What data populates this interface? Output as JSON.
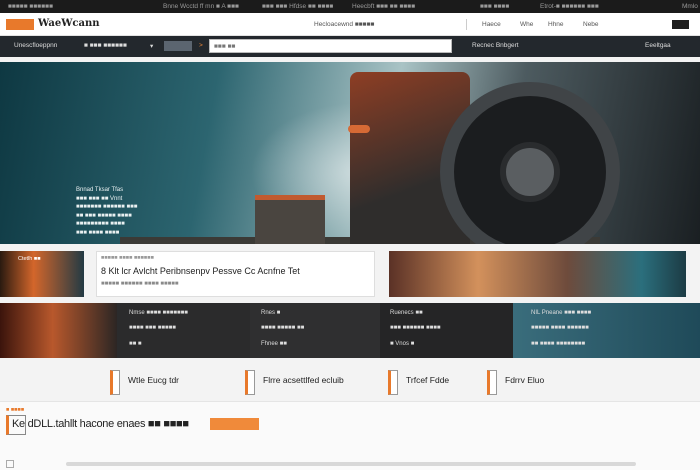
{
  "topbar": {
    "left": "■■■■■ ■■■■■■",
    "items": [
      "Bnne Wcctd ff mn ■ A ■■■",
      "■■■ ■■■ Hfdse ■■ ■■■■",
      "Heecbft ■■■ ■■ ■■■■",
      "■■■ ■■■■",
      "Etrot-■ ■■■■■■ ■■■",
      "Mmlo"
    ]
  },
  "header": {
    "logo": "WaeWcann",
    "nav": [
      "Hecloacewnd ■■■■■",
      "Haece",
      "Whe",
      "Hhne",
      "Nebe"
    ]
  },
  "searchbar": {
    "category": "Unescfloeppnn",
    "sub": "■ ■■■ ■■■■■■",
    "prefix": ">",
    "input_placeholder": "■■■ ■■",
    "action": "Recnec Bnbgert",
    "right": "Eeeltgaa"
  },
  "hero": {
    "lines": [
      "Bnnad Tksar Tfas",
      "■■■ ■■■ ■■ Vnnt",
      "■■■■■■■ ■■■■■■ ■■■",
      "■■ ■■■ ■■■■■ ■■■■",
      "■■■■■■■■■ ■■■■",
      "■■■ ■■■■ ■■■■"
    ]
  },
  "feature": {
    "left_caption": "Ctetlh ■■",
    "card_caption": "■■■■■ ■■■■ ■■■■■■",
    "card_num": "8",
    "card_title": "Klt lcr Avlcht Peribnsenpv Pessve Cc Acnfne Tet",
    "card_sub": "■■■■■ ■■■■■■ ■■■■ ■■■■■"
  },
  "band": [
    {
      "h": "",
      "m": "",
      "l": ""
    },
    {
      "h": "Nmse ■■■■ ■■■■■■■",
      "m": "■■■■ ■■■ ■■■■■",
      "l": "■■ ■"
    },
    {
      "h": "Rnes ■",
      "m": "■■■■ ■■■■■ ■■",
      "l": "Fhnee ■■"
    },
    {
      "h": "Ruenecs ■■",
      "m": "■■■ ■■■■■■ ■■■■",
      "l": "■ Vnos ■"
    },
    {
      "h": "NIL Pneane ■■■ ■■■■",
      "m": "■■■■■ ■■■■ ■■■■■■",
      "l": "■■ ■■■■ ■■■■■■■■"
    }
  ],
  "iconrow": [
    "Wtle Eucg tdr",
    "Flrre acsettlfed ecluib",
    "Trfcef Fdde",
    "Fdrrv Eluo"
  ],
  "footer": {
    "label": "■ ■■■■",
    "title": "Ke dDLL.tahllt hacone enaes ■■ ■■■■"
  }
}
